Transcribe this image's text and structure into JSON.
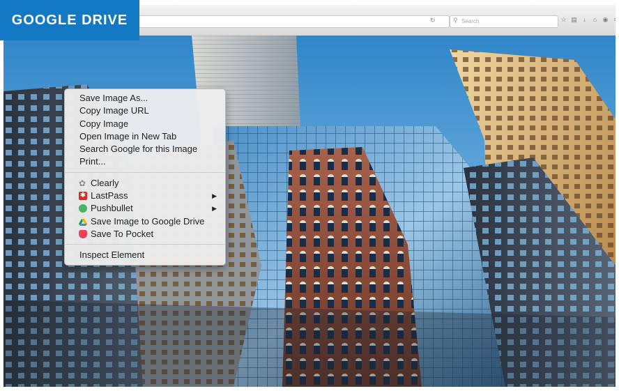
{
  "badge": {
    "label": "GOOGLE DRIVE",
    "color": "#1479c4"
  },
  "browser": {
    "search_placeholder": "Search",
    "reload_icon": "reload-icon",
    "toolbar_icons": [
      "star-icon",
      "bookmarks-icon",
      "download-icon",
      "home-icon",
      "pocket-icon",
      "menu-icon"
    ]
  },
  "context_menu": {
    "group1": [
      "Save Image As...",
      "Copy Image URL",
      "Copy Image",
      "Open Image in New Tab",
      "Search Google for this Image",
      "Print..."
    ],
    "extensions": [
      {
        "label": "Clearly",
        "icon": "clearly-icon",
        "color": "#9a9a9a",
        "submenu": false
      },
      {
        "label": "LastPass",
        "icon": "lastpass-icon",
        "color": "#d32d27",
        "submenu": true
      },
      {
        "label": "Pushbullet",
        "icon": "pushbullet-icon",
        "color": "#4ab367",
        "submenu": true
      },
      {
        "label": "Save Image to Google Drive",
        "icon": "google-drive-icon",
        "color": "#f4b400",
        "submenu": false
      },
      {
        "label": "Save To Pocket",
        "icon": "pocket-icon",
        "color": "#ee4056",
        "submenu": false
      }
    ],
    "group3": [
      "Inspect Element"
    ]
  }
}
